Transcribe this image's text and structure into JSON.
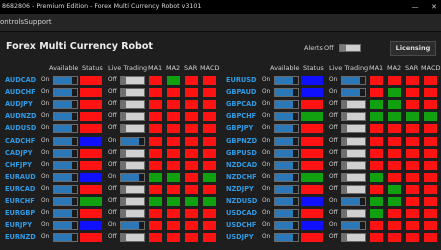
{
  "window": {
    "title": "8682806 - Premium Edition - Forex Multi Currency Robot v3101",
    "minimize_icon": "minimize-icon",
    "close_icon": "close-icon"
  },
  "menu": {
    "items": [
      "ontrols",
      "Support"
    ]
  },
  "header": {
    "title": "Forex Multi Currency Robot",
    "alerts_label": "Alerts",
    "alerts_state": "Off",
    "license_button": "Licensing"
  },
  "columns": [
    "Available",
    "Status",
    "Live Trading",
    "MA1",
    "MA2",
    "SAR",
    "MACD"
  ],
  "colors": {
    "red": "#ff1212",
    "green": "#10a010",
    "blue": "#1010ff",
    "dark_red": "#c81010",
    "symbol": "#2f9be6",
    "toggle_on": "#2b78b8",
    "toggle_off": "#d0d0d0"
  },
  "pairs_left": [
    {
      "symbol": "AUDCAD",
      "available": "On",
      "status": "red",
      "live": "Off",
      "ma1": "red",
      "ma2": "green",
      "sar": "red",
      "macd": "red"
    },
    {
      "symbol": "AUDCHF",
      "available": "On",
      "status": "red",
      "live": "Off",
      "ma1": "red",
      "ma2": "red",
      "sar": "red",
      "macd": "red"
    },
    {
      "symbol": "AUDJPY",
      "available": "On",
      "status": "red",
      "live": "Off",
      "ma1": "red",
      "ma2": "red",
      "sar": "red",
      "macd": "red"
    },
    {
      "symbol": "AUDNZD",
      "available": "On",
      "status": "red",
      "live": "Off",
      "ma1": "red",
      "ma2": "red",
      "sar": "red",
      "macd": "red"
    },
    {
      "symbol": "AUDUSD",
      "available": "On",
      "status": "red",
      "live": "Off",
      "ma1": "red",
      "ma2": "red",
      "sar": "red",
      "macd": "red"
    },
    {
      "symbol": "CADCHF",
      "available": "On",
      "status": "blue",
      "live": "On",
      "ma1": "red",
      "ma2": "red",
      "sar": "red",
      "macd": "red"
    },
    {
      "symbol": "CADJPY",
      "available": "On",
      "status": "red",
      "live": "Off",
      "ma1": "red",
      "ma2": "red",
      "sar": "red",
      "macd": "red"
    },
    {
      "symbol": "CHFJPY",
      "available": "On",
      "status": "red",
      "live": "Off",
      "ma1": "red",
      "ma2": "red",
      "sar": "red",
      "macd": "red"
    },
    {
      "symbol": "EURAUD",
      "available": "On",
      "status": "blue",
      "live": "On",
      "ma1": "green",
      "ma2": "green",
      "sar": "red",
      "macd": "green"
    },
    {
      "symbol": "EURCAD",
      "available": "On",
      "status": "red",
      "live": "Off",
      "ma1": "red",
      "ma2": "red",
      "sar": "red",
      "macd": "red"
    },
    {
      "symbol": "EURCHF",
      "available": "On",
      "status": "green",
      "live": "Off",
      "ma1": "green",
      "ma2": "green",
      "sar": "green",
      "macd": "green"
    },
    {
      "symbol": "EURGBP",
      "available": "On",
      "status": "red",
      "live": "Off",
      "ma1": "red",
      "ma2": "red",
      "sar": "red",
      "macd": "red"
    },
    {
      "symbol": "EURJPY",
      "available": "On",
      "status": "blue",
      "live": "On",
      "ma1": "red",
      "ma2": "red",
      "sar": "red",
      "macd": "red"
    },
    {
      "symbol": "EURNZD",
      "available": "On",
      "status": "red",
      "live": "Off",
      "ma1": "red",
      "ma2": "red",
      "sar": "red",
      "macd": "red"
    }
  ],
  "pairs_right": [
    {
      "symbol": "EURUSD",
      "available": "On",
      "status": "blue",
      "live": "On",
      "ma1": "red",
      "ma2": "red",
      "sar": "red",
      "macd": "red"
    },
    {
      "symbol": "GBPAUD",
      "available": "On",
      "status": "blue",
      "live": "On",
      "ma1": "red",
      "ma2": "green",
      "sar": "red",
      "macd": "red"
    },
    {
      "symbol": "GBPCAD",
      "available": "On",
      "status": "red",
      "live": "Off",
      "ma1": "green",
      "ma2": "green",
      "sar": "red",
      "macd": "red"
    },
    {
      "symbol": "GBPCHF",
      "available": "On",
      "status": "green",
      "live": "Off",
      "ma1": "green",
      "ma2": "green",
      "sar": "green",
      "macd": "green"
    },
    {
      "symbol": "GBPJPY",
      "available": "On",
      "status": "red",
      "live": "Off",
      "ma1": "red",
      "ma2": "red",
      "sar": "red",
      "macd": "red"
    },
    {
      "symbol": "GBPNZD",
      "available": "On",
      "status": "red",
      "live": "Off",
      "ma1": "red",
      "ma2": "red",
      "sar": "red",
      "macd": "red"
    },
    {
      "symbol": "GBPUSD",
      "available": "On",
      "status": "red",
      "live": "Off",
      "ma1": "red",
      "ma2": "red",
      "sar": "red",
      "macd": "red"
    },
    {
      "symbol": "NZDCAD",
      "available": "On",
      "status": "red",
      "live": "Off",
      "ma1": "red",
      "ma2": "red",
      "sar": "red",
      "macd": "red"
    },
    {
      "symbol": "NZDCHF",
      "available": "On",
      "status": "green",
      "live": "Off",
      "ma1": "green",
      "ma2": "red",
      "sar": "red",
      "macd": "red"
    },
    {
      "symbol": "NZDJPY",
      "available": "On",
      "status": "red",
      "live": "Off",
      "ma1": "red",
      "ma2": "green",
      "sar": "red",
      "macd": "red"
    },
    {
      "symbol": "NZDUSD",
      "available": "On",
      "status": "blue",
      "live": "On",
      "ma1": "green",
      "ma2": "green",
      "sar": "red",
      "macd": "red"
    },
    {
      "symbol": "USDCAD",
      "available": "On",
      "status": "red",
      "live": "Off",
      "ma1": "green",
      "ma2": "red",
      "sar": "red",
      "macd": "red"
    },
    {
      "symbol": "USDCHF",
      "available": "On",
      "status": "blue",
      "live": "On",
      "ma1": "red",
      "ma2": "red",
      "sar": "red",
      "macd": "red"
    },
    {
      "symbol": "USDJPY",
      "available": "On",
      "status": "red",
      "live": "Off",
      "ma1": "red",
      "ma2": "red",
      "sar": "red",
      "macd": "red"
    }
  ]
}
